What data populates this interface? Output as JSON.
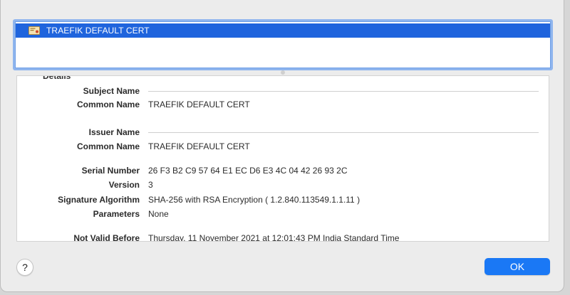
{
  "certificate_list": {
    "items": [
      {
        "label": "TRAEFIK DEFAULT CERT",
        "selected": true,
        "icon": "certificate-icon"
      }
    ]
  },
  "details": {
    "section_title": "Details",
    "subject": {
      "heading": "Subject Name",
      "common_name_label": "Common Name",
      "common_name_value": "TRAEFIK DEFAULT CERT"
    },
    "issuer": {
      "heading": "Issuer Name",
      "common_name_label": "Common Name",
      "common_name_value": "TRAEFIK DEFAULT CERT"
    },
    "serial_number_label": "Serial Number",
    "serial_number_value": "26 F3 B2 C9 57 64 E1 EC D6 E3 4C 04 42 26 93 2C",
    "version_label": "Version",
    "version_value": "3",
    "signature_algorithm_label": "Signature Algorithm",
    "signature_algorithm_value": "SHA-256 with RSA Encryption ( 1.2.840.113549.1.1.11 )",
    "parameters_label": "Parameters",
    "parameters_value": "None",
    "not_valid_before_label": "Not Valid Before",
    "not_valid_before_value": "Thursday, 11 November 2021 at 12:01:43 PM India Standard Time"
  },
  "buttons": {
    "help_label": "?",
    "ok_label": "OK"
  },
  "colors": {
    "selection": "#1f64dd",
    "accent_button": "#1a78f5",
    "focus_ring": "#8fb5ee"
  }
}
